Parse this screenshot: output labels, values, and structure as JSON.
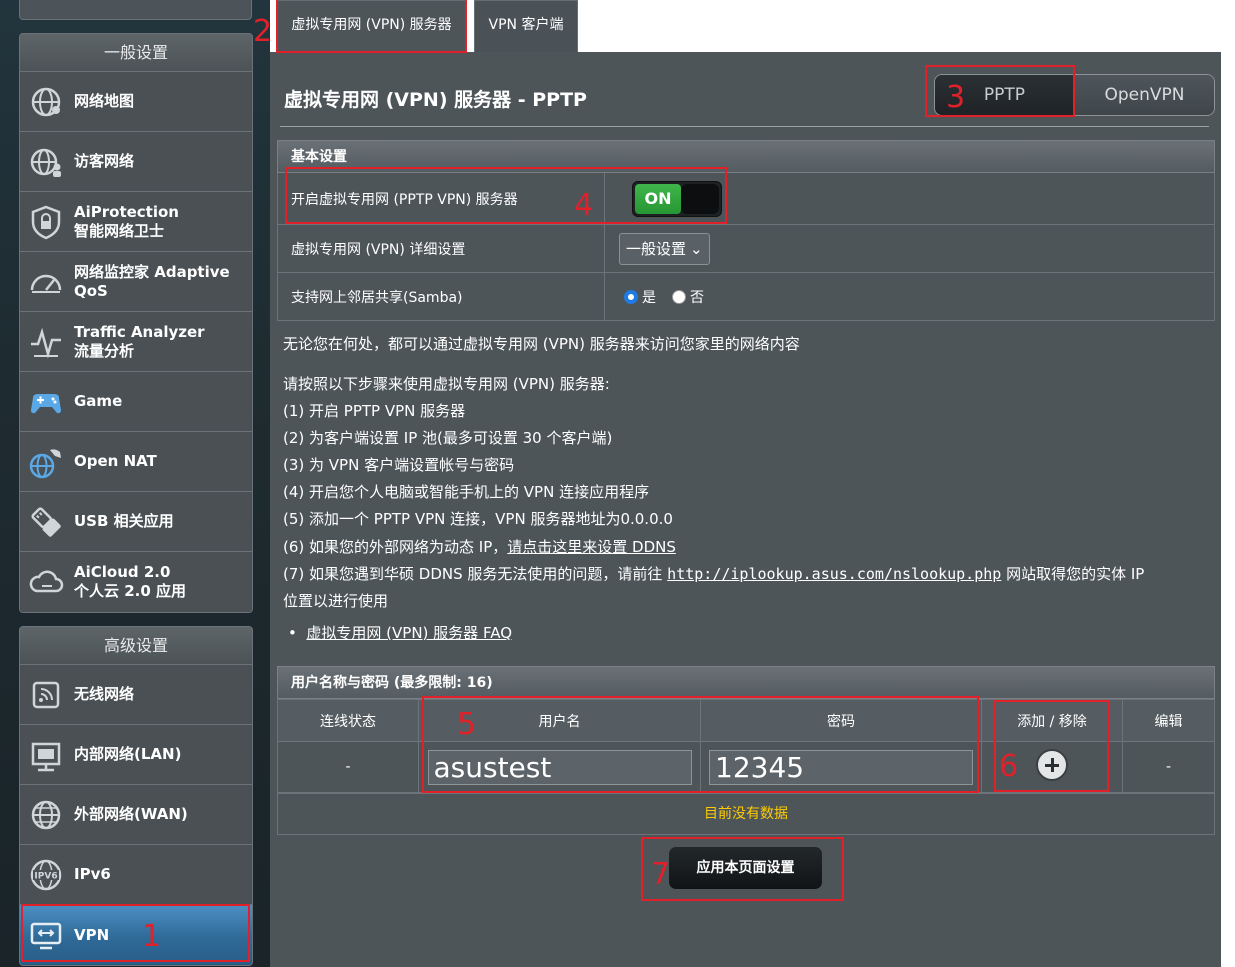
{
  "sidebar": {
    "general_header": "一般设置",
    "general_items": [
      {
        "label": "网络地图"
      },
      {
        "label": "访客网络"
      },
      {
        "label": "AiProtection\n智能网络卫士"
      },
      {
        "label": "网络监控家 Adaptive\nQoS"
      },
      {
        "label": "Traffic Analyzer\n流量分析"
      },
      {
        "label": "Game"
      },
      {
        "label": "Open NAT"
      },
      {
        "label": "USB 相关应用"
      },
      {
        "label": "AiCloud 2.0\n个人云 2.0 应用"
      }
    ],
    "advanced_header": "高级设置",
    "advanced_items": [
      {
        "label": "无线网络"
      },
      {
        "label": "内部网络(LAN)"
      },
      {
        "label": "外部网络(WAN)"
      },
      {
        "label": "IPv6"
      },
      {
        "label": "VPN"
      }
    ]
  },
  "tabs": {
    "vpn_server": "虚拟专用网 (VPN) 服务器",
    "vpn_client": "VPN 客户端"
  },
  "page_title": "虚拟专用网 (VPN) 服务器 - PPTP",
  "protocol": {
    "pptp": "PPTP",
    "openvpn": "OpenVPN",
    "selected": "PPTP"
  },
  "basic": {
    "header": "基本设置",
    "enable_label": "开启虚拟专用网 (PPTP VPN) 服务器",
    "enable_state": "ON",
    "detail_label": "虚拟专用网 (VPN) 详细设置",
    "detail_value": "一般设置",
    "samba_label": "支持网上邻居共享(Samba)",
    "samba_yes": "是",
    "samba_no": "否",
    "samba_selected": "是"
  },
  "info": {
    "intro": "无论您在何处，都可以通过虚拟专用网 (VPN) 服务器来访问您家里的网络内容",
    "steps_title": "请按照以下步骤来使用虚拟专用网 (VPN) 服务器:",
    "step1": "(1) 开启 PPTP VPN 服务器",
    "step2": "(2) 为客户端设置 IP 池(最多可设置 30 个客户端)",
    "step3": "(3) 为 VPN 客户端设置帐号与密码",
    "step4": "(4) 开启您个人电脑或智能手机上的 VPN 连接应用程序",
    "step5": "(5) 添加一个 PPTP VPN 连接，VPN 服务器地址为0.0.0.0",
    "step6_prefix": "(6) 如果您的外部网络为动态 IP，",
    "step6_link": "请点击这里来设置 DDNS",
    "step7_prefix": "(7) 如果您遇到华硕 DDNS 服务无法使用的问题，请前往 ",
    "step7_link": "http://iplookup.asus.com/nslookup.php",
    "step7_suffix": " 网站取得您的实体 IP",
    "step7_cont": "位置以进行使用",
    "faq": "虚拟专用网 (VPN) 服务器 FAQ"
  },
  "users": {
    "header": "用户名称与密码 (最多限制: 16)",
    "col_status": "连线状态",
    "col_username": "用户名",
    "col_password": "密码",
    "col_add": "添加 / 移除",
    "col_edit": "编辑",
    "row_status": "-",
    "username_value": "asustest",
    "password_value": "12345",
    "row_edit": "-",
    "no_data": "目前没有数据"
  },
  "apply_label": "应用本页面设置",
  "annotations": [
    "1",
    "2",
    "3",
    "4",
    "5",
    "6",
    "7"
  ],
  "colors": {
    "annotation": "#e0212a",
    "toggle_on": "#3fb64a",
    "no_data": "#ffcc00",
    "active_nav": "#2f6a98"
  }
}
